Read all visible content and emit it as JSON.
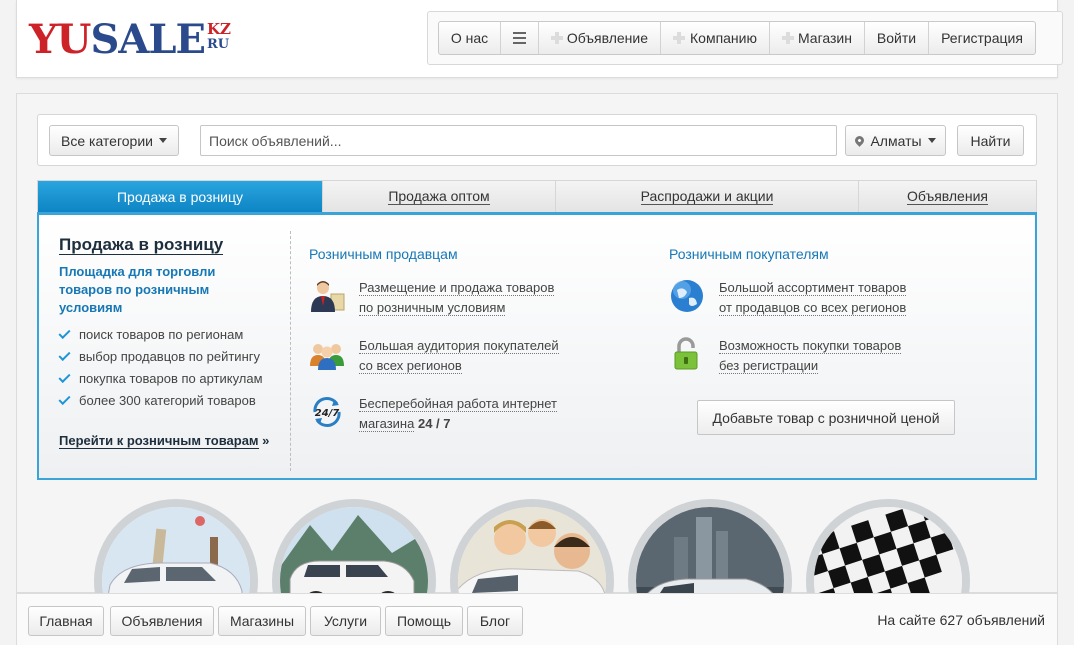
{
  "logo": {
    "main": "YUSALE",
    "tld_top": "KZ",
    "tld_bottom": "RU"
  },
  "topnav": {
    "about": "О нас",
    "menu_icon": "menu-icon",
    "ad": "Объявление",
    "company": "Компанию",
    "shop": "Магазин",
    "login": "Войти",
    "register": "Регистрация"
  },
  "search": {
    "categories": "Все категории",
    "placeholder": "Поиск объявлений...",
    "city": "Алматы",
    "submit": "Найти"
  },
  "tabs": [
    {
      "label": "Продажа в розницу",
      "active": true
    },
    {
      "label": "Продажа оптом",
      "active": false
    },
    {
      "label": "Распродажи и акции",
      "active": false
    },
    {
      "label": "Объявления",
      "active": false
    }
  ],
  "panel": {
    "title": "Продажа в розницу",
    "subtitle": "Площадка для торговли товаров по розничным условиям",
    "checks": [
      "поиск товаров по регионам",
      "выбор продавцов по рейтингу",
      "покупка товаров по артикулам",
      "более 300 категорий товаров"
    ],
    "link": "Перейти к розничным товарам",
    "link_arrow": "»",
    "sellers_heading": "Розничным продавцам",
    "sellers": [
      {
        "icon": "businessman-icon",
        "line1": "Размещение и продажа товаров",
        "line2": "по розничным условиям",
        "bold": ""
      },
      {
        "icon": "audience-icon",
        "line1": "Большая аудитория покупателей",
        "line2": "со всех регионов",
        "bold": ""
      },
      {
        "icon": "24-7-icon",
        "line1": "Бесперебойная работа интернет",
        "line2": "магазина",
        "bold": "24 / 7"
      }
    ],
    "buyers_heading": "Розничным покупателям",
    "buyers": [
      {
        "icon": "globe-icon",
        "line1": "Большой ассортимент товаров",
        "line2": "от продавцов со всех регионов"
      },
      {
        "icon": "padlock-icon",
        "line1": "Возможность покупки товаров",
        "line2": "без регистрации"
      }
    ],
    "add_button": "Добавьте товар с розничной ценой"
  },
  "circles": [
    "car-travel-image",
    "suv-mountains-image",
    "family-car-image",
    "city-car-image",
    "race-flag-image"
  ],
  "footer": {
    "links": [
      "Главная",
      "Объявления",
      "Магазины",
      "Услуги",
      "Помощь",
      "Блог"
    ],
    "count": "На сайте 627 объявлений"
  },
  "colors": {
    "accent": "#1e95d6",
    "logo_red": "#cc2228",
    "logo_blue": "#2a4a8c",
    "link_blue": "#1778b5"
  }
}
